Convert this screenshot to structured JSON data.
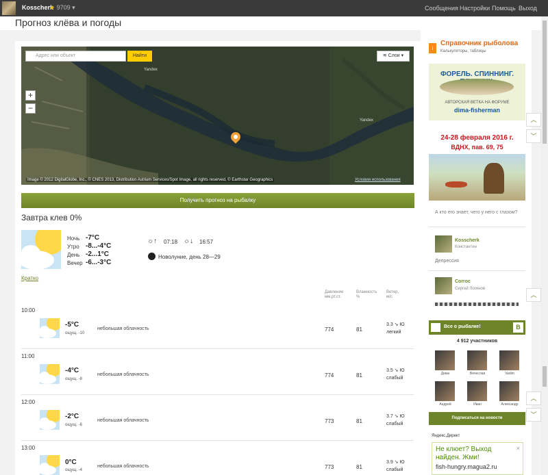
{
  "topbar": {
    "username": "Kosscherk",
    "rating": "9709",
    "nav": [
      "Сообщения",
      "Настройки",
      "Помощь",
      "Выход"
    ]
  },
  "page": {
    "title": "Прогноз клёва и погоды"
  },
  "map": {
    "search_placeholder": "Адрес или объект",
    "find_label": "Найти",
    "layers_label": "Слои",
    "zoom_in": "+",
    "zoom_out": "−",
    "watermark": "Yandex",
    "copyright": "Image © 2012 DigitalGlobe, Inc., © CNES 2013, Distribution Astrium Services/Spot Image, all rights reserved, © Earthstar Geographics",
    "terms": "Условия использования"
  },
  "forecast_button": "Получить прогноз на рыбалку",
  "summary": {
    "title": "Завтра клев 0%",
    "night_label": "Ночь",
    "night_value": "-7°C",
    "morning_label": "Утро",
    "morning_value": "-8...-4°C",
    "day_label": "День",
    "day_value": "-2...1°C",
    "evening_label": "Вечер",
    "evening_value": "-6...-3°C",
    "sunrise": "07:18",
    "sunset": "16:57",
    "moon": "Новолуние, день 28—29",
    "brief_link": "Кратко"
  },
  "columns": {
    "pressure": [
      "Давление",
      "мм.рт.ст."
    ],
    "humidity": [
      "Влажность",
      "%"
    ],
    "wind": [
      "Ветер,",
      "м/с"
    ]
  },
  "hours": [
    {
      "time": "10:00",
      "temp": "-5°C",
      "feel": "ощущ. -10",
      "desc": "небольшая облачность",
      "pressure": "774",
      "humidity": "81",
      "wind_speed": "3.3",
      "wind_dir": "Ю",
      "wind_text": "легкий"
    },
    {
      "time": "11:00",
      "temp": "-4°C",
      "feel": "ощущ. -8",
      "desc": "небольшая облачность",
      "pressure": "774",
      "humidity": "81",
      "wind_speed": "3.5",
      "wind_dir": "Ю",
      "wind_text": "слабый"
    },
    {
      "time": "12:00",
      "temp": "-2°C",
      "feel": "ощущ. -6",
      "desc": "небольшая облачность",
      "pressure": "773",
      "humidity": "81",
      "wind_speed": "3.7",
      "wind_dir": "Ю",
      "wind_text": "слабый"
    },
    {
      "time": "13:00",
      "temp": "0°C",
      "feel": "ощущ. -4",
      "desc": "небольшая облачность",
      "pressure": "773",
      "humidity": "81",
      "wind_speed": "3.9",
      "wind_dir": "Ю",
      "wind_text": "слабый"
    }
  ],
  "sidebar": {
    "ref_title": "Справочник рыболова",
    "ref_sub": "Калькуляторы, таблицы",
    "ad1_title": "ФОРЕЛЬ. СПИННИНГ. ПЛАТНИК.",
    "ad1_sub": "АВТОРСКАЯ ВЕТКА НА ФОРУМЕ",
    "ad1_site": "dima-fisherman",
    "ad2_dates": "24-28 февраля 2016 г.",
    "ad2_venue": "ВДНХ, пав. 69, 75",
    "question": "А кто его знает, чего у него с глазом?",
    "user1_name": "Kosscherk",
    "user1_real": "Константин",
    "user1_text": "Депрессия",
    "user2_name": "Corroc",
    "user2_real": "Сергей Логинов",
    "vk_title": "Все о рыбалке!",
    "vk_logo": "В",
    "members": "4 912 участников",
    "people": [
      "Дима",
      "Вячеслав",
      "Vadim",
      "Андрей",
      "Иван",
      "Александр"
    ],
    "subscribe": "Подписаться на новости",
    "direct": "Яндекс.Директ",
    "ad3_text": "Не клюет? Выход найден. Жми!",
    "ad3_site": "fish-hungry.magua2.ru",
    "ad3_close": "×"
  },
  "colors": {
    "accent": "#6d8528",
    "orange": "#e06a1a",
    "topbar": "#3a3a3a"
  }
}
